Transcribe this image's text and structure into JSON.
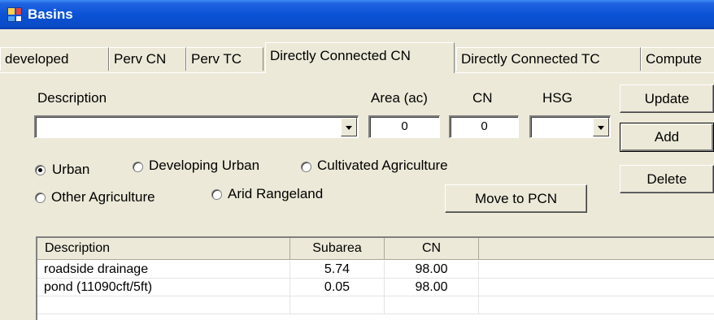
{
  "window": {
    "title": "Basins",
    "icon": "app-window-icon"
  },
  "tabs": [
    {
      "label": "developed",
      "active": false
    },
    {
      "label": "Perv CN",
      "active": false
    },
    {
      "label": "Perv TC",
      "active": false
    },
    {
      "label": "Directly Connected CN",
      "active": true
    },
    {
      "label": "Directly Connected TC",
      "active": false
    },
    {
      "label": "Compute",
      "active": false
    }
  ],
  "form": {
    "description_label": "Description",
    "description_value": "",
    "area_label": "Area (ac)",
    "area_value": "0",
    "cn_label": "CN",
    "cn_value": "0",
    "hsg_label": "HSG",
    "hsg_value": ""
  },
  "buttons": {
    "update": "Update",
    "add": "Add",
    "delete": "Delete",
    "move_to_pcn": "Move to PCN"
  },
  "land_use": {
    "options": [
      "Urban",
      "Developing Urban",
      "Cultivated Agriculture",
      "Other Agriculture",
      "Arid Rangeland"
    ],
    "selected": "Urban"
  },
  "table": {
    "columns": [
      "Description",
      "Subarea",
      "CN"
    ],
    "rows": [
      [
        "roadside drainage",
        "5.74",
        "98.00"
      ],
      [
        "pond (11090cft/5ft)",
        "0.05",
        "98.00"
      ],
      [
        "",
        "",
        ""
      ]
    ]
  },
  "colors": {
    "title_bar": "#0a52d6",
    "face": "#ece9d8"
  }
}
